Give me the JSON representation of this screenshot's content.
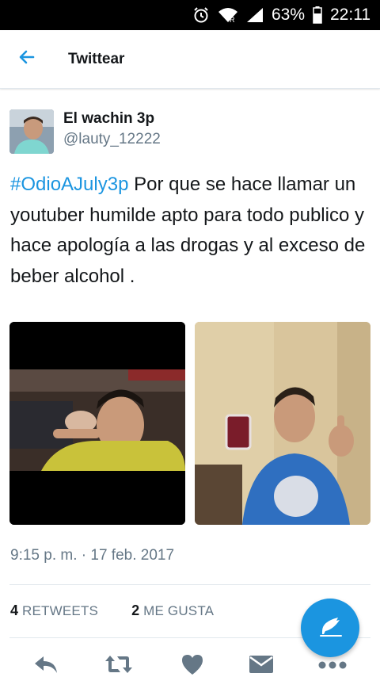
{
  "status_bar": {
    "battery_percent": "63%",
    "time": "22:11",
    "icons": [
      "alarm-icon",
      "wifi-icon",
      "signal-icon",
      "battery-icon"
    ]
  },
  "header": {
    "title": "Twittear",
    "back_icon": "arrow-left-icon"
  },
  "tweet": {
    "author_name": "El wachin 3p",
    "author_handle": "@lauty_12222",
    "hashtag": "#OdioAJuly3p",
    "text": " Por que se hace llamar un youtuber humilde apto para todo publico y hace apología a las drogas y al exceso de beber alcohol .",
    "timestamp": "9:15 p. m. · 17 feb. 2017",
    "retweets_count": "4",
    "retweets_label": "RETWEETS",
    "likes_count": "2",
    "likes_label": "ME GUSTA",
    "media": [
      {
        "description": "photo-young-man-drinking"
      },
      {
        "description": "photo-young-man-holding-glass-thumbs-up"
      }
    ]
  },
  "actions": [
    "reply-icon",
    "retweet-icon",
    "heart-icon",
    "direct-message-icon",
    "more-icon"
  ],
  "fab": {
    "icon": "compose-tweet-icon"
  },
  "colors": {
    "accent": "#1b95e0",
    "text_primary": "#14171a",
    "text_secondary": "#657786",
    "action_icon": "#657786"
  }
}
